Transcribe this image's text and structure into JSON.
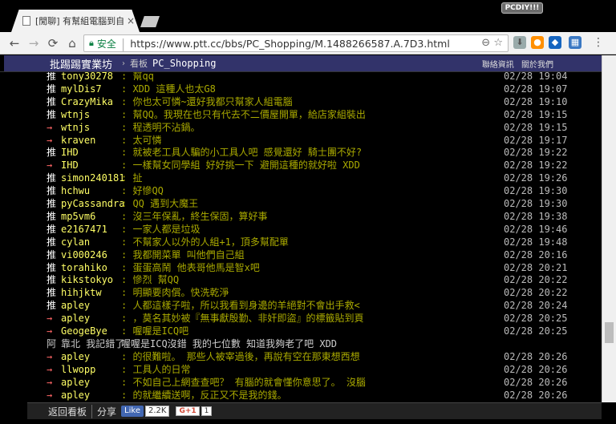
{
  "browser": {
    "tab_title": "[閒聊] 有幫組電腦到自己",
    "tab_close": "×",
    "profile_badge": "PCDIY!!!",
    "secure_label": "安全",
    "url": "https://www.ptt.cc/bbs/PC_Shopping/M.1488266587.A.7D3.html"
  },
  "ptt_header": {
    "brand": "批踢踢實業坊",
    "crumb_label": "看板",
    "board": "PC_Shopping",
    "links": [
      "聯絡資訊",
      "關於我們"
    ]
  },
  "comments": [
    {
      "tag": "推",
      "user": "tony30278",
      "msg": ": 幫qq",
      "time": "02/28 19:04"
    },
    {
      "tag": "推",
      "user": "mylDis7",
      "msg": ": XDD 這種人也太G8",
      "time": "02/28 19:07"
    },
    {
      "tag": "推",
      "user": "CrazyMika",
      "msg": ": 你也太可憐~還好我都只幫家人組電腦",
      "time": "02/28 19:10"
    },
    {
      "tag": "推",
      "user": "wtnjs",
      "msg": ": 幫QQ。我現在也只有代去不二價屋開單，給店家組裝出",
      "time": "02/28 19:15"
    },
    {
      "tag": "→",
      "user": "wtnjs",
      "msg": ": 程透明不沾鍋。",
      "time": "02/28 19:15"
    },
    {
      "tag": "→",
      "user": "kraven",
      "msg": ": 太可憐",
      "time": "02/28 19:17"
    },
    {
      "tag": "推",
      "user": "IHD",
      "msg": ": 就被老工具人騙的小工具人吧 感覺還好 騎士團不好?",
      "time": "02/28 19:22"
    },
    {
      "tag": "→",
      "user": "IHD",
      "msg": ": 一樣幫女同學組 好好挑一下 避開這種的就好啦 XDD",
      "time": "02/28 19:22"
    },
    {
      "tag": "推",
      "user": "simon240181",
      "msg": ": 扯",
      "time": "02/28 19:26"
    },
    {
      "tag": "推",
      "user": "hchwu",
      "msg": ": 好慘QQ",
      "time": "02/28 19:30"
    },
    {
      "tag": "推",
      "user": "pyCassandra",
      "msg": ": QQ 遇到大魔王",
      "time": "02/28 19:30"
    },
    {
      "tag": "推",
      "user": "mp5vm6",
      "msg": ": 沒三年保亂，終生保固，算好事",
      "time": "02/28 19:38"
    },
    {
      "tag": "推",
      "user": "e2167471",
      "msg": ": 一家人都是垃圾",
      "time": "02/28 19:46"
    },
    {
      "tag": "推",
      "user": "cylan",
      "msg": ": 不幫家人以外的人組+1，頂多幫配單",
      "time": "02/28 19:48"
    },
    {
      "tag": "推",
      "user": "vi000246",
      "msg": ": 我都開菜單 叫他們自己組",
      "time": "02/28 20:16"
    },
    {
      "tag": "推",
      "user": "torahiko",
      "msg": ": 蛋蛋高鬧 他表哥他馬是智x吧",
      "time": "02/28 20:21"
    },
    {
      "tag": "推",
      "user": "kikstokyo",
      "msg": ": 慘烈 幫QQ",
      "time": "02/28 20:22"
    },
    {
      "tag": "推",
      "user": "hihjktw",
      "msg": ": 明顯要肉償。快洗乾淨",
      "time": "02/28 20:22"
    },
    {
      "tag": "推",
      "user": "apley",
      "msg": ": 人都這樣子啦，所以我看到身邊的羊絕對不會出手救<",
      "time": "02/28 20:24"
    },
    {
      "tag": "→",
      "user": "apley",
      "msg": ": ，莫名其妙被『無事獻殷勤、非奸即盜』的標籤貼到頁",
      "time": "02/28 20:25"
    },
    {
      "tag": "→",
      "user": "GeogeBye",
      "msg": ": 喔喔是ICQ吧",
      "time": "02/28 20:25"
    },
    {
      "tag": "阿",
      "user": "靠北 我記錯了",
      "msg": "喔喔是ICQ沒錯 我的七位數 知道我夠老了吧 XDD",
      "time": "",
      "plain": true
    },
    {
      "tag": "→",
      "user": "apley",
      "msg": ": 的很難啦。 那些人被宰過後，再說有空在那東想西想",
      "time": "02/28 20:26"
    },
    {
      "tag": "→",
      "user": "llwopp",
      "msg": ": 工具人的日常",
      "time": "02/28 20:26"
    },
    {
      "tag": "→",
      "user": "apley",
      "msg": ": 不如自己上網查查吧？ 有腦的就會懂你意思了。 沒腦",
      "time": "02/28 20:26"
    },
    {
      "tag": "→",
      "user": "apley",
      "msg": ": 的就繼續送啊，反正又不是我的錢。",
      "time": "02/28 20:26"
    }
  ],
  "footer": {
    "back_label": "返回看板",
    "share_label": "分享",
    "fb_like": "Like",
    "fb_count": "2.2K",
    "gplus": "G+1",
    "gplus_count": "1"
  },
  "colors": {
    "header_bar": "#32336a",
    "push_user": "#ffff66",
    "push_msg": "#aaaa00",
    "arrow": "#ff6666"
  }
}
